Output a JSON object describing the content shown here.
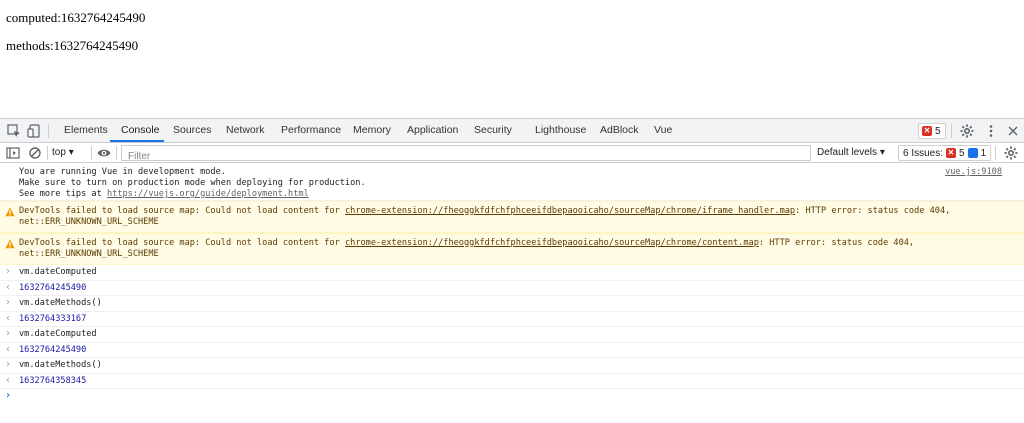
{
  "page": {
    "computed_line": "computed:1632764245490",
    "methods_line": "methods:1632764245490"
  },
  "devtools": {
    "tabs": [
      "Elements",
      "Console",
      "Sources",
      "Network",
      "Performance",
      "Memory",
      "Application",
      "Security",
      "Lighthouse",
      "AdBlock",
      "Vue"
    ],
    "active_tab": "Console",
    "error_count": "5",
    "toolbar": {
      "context": "top",
      "filter_placeholder": "Filter",
      "levels": "Default levels",
      "issues_label": "6 Issues:",
      "issues_errors": "5",
      "issues_messages": "1"
    },
    "console": {
      "info": {
        "line1": "You are running Vue in development mode.",
        "line2": "Make sure to turn on production mode when deploying for production.",
        "line3_prefix": "See more tips at ",
        "line3_link": "https://vuejs.org/guide/deployment.html",
        "source": "vue.js:9108"
      },
      "warnings": [
        {
          "prefix": "DevTools failed to load source map: Could not load content for ",
          "link": "chrome-extension://fheoggkfdfchfphceeifdbepaooicaho/sourceMap/chrome/iframe_handler.map",
          "suffix": ": HTTP error: status code 404,",
          "line2": "net::ERR_UNKNOWN_URL_SCHEME"
        },
        {
          "prefix": "DevTools failed to load source map: Could not load content for ",
          "link": "chrome-extension://fheoggkfdfchfphceeifdbepaooicaho/sourceMap/chrome/content.map",
          "suffix": ": HTTP error: status code 404,",
          "line2": "net::ERR_UNKNOWN_URL_SCHEME"
        }
      ],
      "entries": [
        {
          "input": "vm.dateComputed",
          "output": "1632764245490"
        },
        {
          "input": "vm.dateMethods()",
          "output": "1632764333167"
        },
        {
          "input": "vm.dateComputed",
          "output": "1632764245490"
        },
        {
          "input": "vm.dateMethods()",
          "output": "1632764358345"
        }
      ]
    },
    "colors": {
      "accent": "#1a73e8",
      "error": "#d93025",
      "warning_bg": "#fffbe5",
      "result_text": "#1a1aa6"
    }
  }
}
